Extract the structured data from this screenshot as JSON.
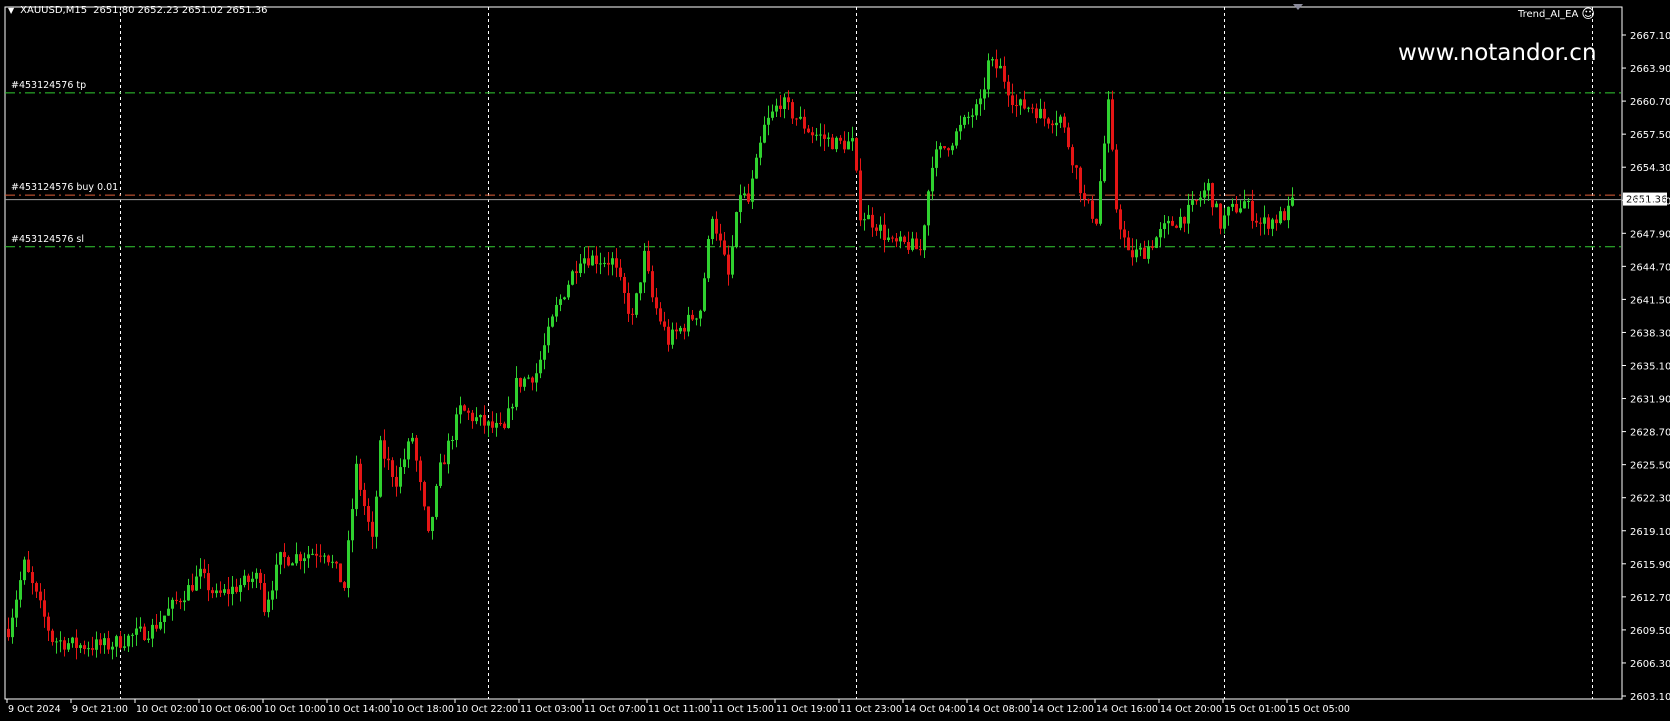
{
  "header": {
    "symbol_timeframe": "XAUUSD,M15",
    "open": "2651.80",
    "high": "2652.23",
    "low": "2651.02",
    "close": "2651.36"
  },
  "expert": {
    "name": "Trend_AI_EA",
    "icon": "smiley-icon"
  },
  "watermark": "www.notandor.cn",
  "orders": {
    "tp": {
      "label": "#453124576 tp",
      "price": 2661.5,
      "color": "#32cd32"
    },
    "buy": {
      "label": "#453124576 buy 0.01",
      "price": 2651.6,
      "color": "#e0603a"
    },
    "sl": {
      "label": "#453124576 sl",
      "price": 2646.6,
      "color": "#32cd32"
    }
  },
  "colors": {
    "bull": "#2fd12f",
    "bear": "#e51515",
    "grid": "#ffffff",
    "axis": "#ffffff",
    "current_line": "#a0a0a0"
  },
  "chart_data": {
    "type": "candlestick",
    "title": "XAUUSD,M15",
    "ylim": [
      2603.1,
      2667.1
    ],
    "current_price": "2651.36",
    "price_ticks": [
      "2667.10",
      "2663.90",
      "2660.70",
      "2657.50",
      "2654.30",
      "2651.10",
      "2647.90",
      "2644.70",
      "2641.50",
      "2638.30",
      "2635.10",
      "2631.90",
      "2628.70",
      "2625.50",
      "2622.30",
      "2619.10",
      "2615.90",
      "2612.70",
      "2609.50",
      "2606.30",
      "2603.10"
    ],
    "time_labels": [
      "9 Oct 2024",
      "9 Oct 21:00",
      "10 Oct 02:00",
      "10 Oct 06:00",
      "10 Oct 10:00",
      "10 Oct 14:00",
      "10 Oct 18:00",
      "10 Oct 22:00",
      "11 Oct 03:00",
      "11 Oct 07:00",
      "11 Oct 11:00",
      "11 Oct 15:00",
      "11 Oct 19:00",
      "11 Oct 23:00",
      "14 Oct 04:00",
      "14 Oct 08:00",
      "14 Oct 12:00",
      "14 Oct 16:00",
      "14 Oct 20:00",
      "15 Oct 01:00",
      "15 Oct 05:00"
    ],
    "bars_per_time_label": 16,
    "separator_bars": [
      28,
      120,
      212,
      304,
      396
    ],
    "bar_count": 322,
    "close_path": [
      [
        0,
        2609.6
      ],
      [
        4,
        2615.8
      ],
      [
        11,
        2608.6
      ],
      [
        17,
        2608
      ],
      [
        25,
        2608
      ],
      [
        36,
        2609.6
      ],
      [
        48,
        2614.8
      ],
      [
        52,
        2612.7
      ],
      [
        63,
        2614.8
      ],
      [
        64,
        2611.7
      ],
      [
        68,
        2616.3
      ],
      [
        79,
        2617.3
      ],
      [
        84,
        2613.7
      ],
      [
        87,
        2625.1
      ],
      [
        91,
        2617.9
      ],
      [
        93,
        2627.1
      ],
      [
        97,
        2624
      ],
      [
        101,
        2628.2
      ],
      [
        105,
        2618.4
      ],
      [
        108,
        2625
      ],
      [
        113,
        2630.8
      ],
      [
        120,
        2629.2
      ],
      [
        124,
        2628.7
      ],
      [
        127,
        2633.3
      ],
      [
        132,
        2634.4
      ],
      [
        137,
        2640.6
      ],
      [
        143,
        2645.7
      ],
      [
        151,
        2645.2
      ],
      [
        156,
        2639.5
      ],
      [
        159,
        2645.7
      ],
      [
        161,
        2641.6
      ],
      [
        165,
        2637.5
      ],
      [
        169,
        2639
      ],
      [
        173,
        2640.6
      ],
      [
        176,
        2649.9
      ],
      [
        180,
        2643.7
      ],
      [
        183,
        2651.9
      ],
      [
        185,
        2650.9
      ],
      [
        189,
        2658.1
      ],
      [
        193,
        2660.7
      ],
      [
        197,
        2659.1
      ],
      [
        201,
        2657.6
      ],
      [
        207,
        2656.6
      ],
      [
        211,
        2656.6
      ],
      [
        213,
        2649.9
      ],
      [
        217,
        2648.8
      ],
      [
        221,
        2646.8
      ],
      [
        225,
        2646.8
      ],
      [
        228,
        2646.2
      ],
      [
        231,
        2655
      ],
      [
        236,
        2657
      ],
      [
        240,
        2659.1
      ],
      [
        243,
        2660.2
      ],
      [
        245,
        2664.3
      ],
      [
        248,
        2663.8
      ],
      [
        252,
        2660.2
      ],
      [
        256,
        2660.2
      ],
      [
        259,
        2659.1
      ],
      [
        263,
        2659.1
      ],
      [
        267,
        2654
      ],
      [
        269,
        2650.9
      ],
      [
        272,
        2649.3
      ],
      [
        275,
        2660.2
      ],
      [
        277,
        2650.4
      ],
      [
        280,
        2645.7
      ],
      [
        284,
        2646.2
      ],
      [
        289,
        2648.3
      ],
      [
        295,
        2649.9
      ],
      [
        300,
        2652.4
      ],
      [
        303,
        2648.8
      ],
      [
        305,
        2649.9
      ],
      [
        309,
        2650.9
      ],
      [
        313,
        2648.8
      ],
      [
        317,
        2649.3
      ],
      [
        320,
        2649.9
      ],
      [
        321,
        2651.36
      ]
    ]
  }
}
